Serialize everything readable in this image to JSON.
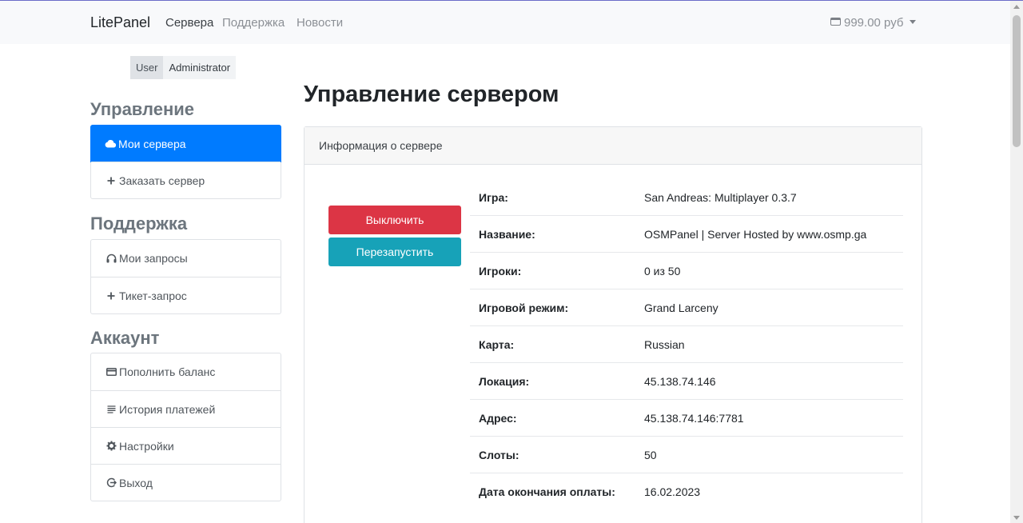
{
  "navbar": {
    "brand": "LitePanel",
    "links": [
      "Сервера",
      "Поддержка",
      "Новости"
    ],
    "balance": "999.00 руб"
  },
  "roles": [
    "User",
    "Administrator"
  ],
  "sidebar": {
    "sections": [
      {
        "title": "Управление",
        "items": [
          {
            "icon": "cloud-icon",
            "label": "Мои сервера"
          },
          {
            "icon": "plus-icon",
            "label": "Заказать сервер"
          }
        ]
      },
      {
        "title": "Поддержка",
        "items": [
          {
            "icon": "headphones-icon",
            "label": "Мои запросы"
          },
          {
            "icon": "plus-icon",
            "label": "Тикет-запрос"
          }
        ]
      },
      {
        "title": "Аккаунт",
        "items": [
          {
            "icon": "credit-card-icon",
            "label": "Пополнить баланс"
          },
          {
            "icon": "list-icon",
            "label": "История платежей"
          },
          {
            "icon": "gear-icon",
            "label": "Настройки"
          },
          {
            "icon": "logout-icon",
            "label": "Выход"
          }
        ]
      }
    ]
  },
  "main": {
    "title": "Управление сервером",
    "card_title": "Информация о сервере",
    "buttons": {
      "stop": "Выключить",
      "restart": "Перезапустить"
    },
    "info": [
      {
        "key": "Игра:",
        "value": "San Andreas: Multiplayer 0.3.7"
      },
      {
        "key": "Название:",
        "value": "OSMPanel | Server Hosted by www.osmp.ga"
      },
      {
        "key": "Игроки:",
        "value": "0 из 50"
      },
      {
        "key": "Игровой режим:",
        "value": "Grand Larceny"
      },
      {
        "key": "Карта:",
        "value": "Russian"
      },
      {
        "key": "Локация:",
        "value": "45.138.74.146"
      },
      {
        "key": "Адрес:",
        "value": "45.138.74.146:7781"
      },
      {
        "key": "Слоты:",
        "value": "50"
      },
      {
        "key": "Дата окончания оплаты:",
        "value": "16.02.2023"
      }
    ]
  },
  "colors": {
    "primary": "#007bff",
    "danger": "#dc3545",
    "info": "#17a2b8"
  }
}
